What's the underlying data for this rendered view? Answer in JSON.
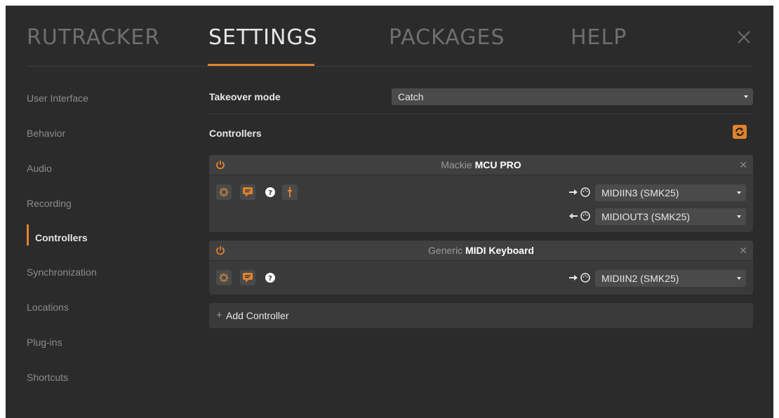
{
  "header": {
    "tabs": [
      {
        "label": "RUTRACKER",
        "active": false
      },
      {
        "label": "SETTINGS",
        "active": true
      },
      {
        "label": "PACKAGES",
        "active": false
      },
      {
        "label": "HELP",
        "active": false
      }
    ],
    "close_icon": "close-icon"
  },
  "sidebar": {
    "items": [
      {
        "label": "User Interface"
      },
      {
        "label": "Behavior"
      },
      {
        "label": "Audio"
      },
      {
        "label": "Recording"
      },
      {
        "label": "Controllers",
        "active": true
      },
      {
        "label": "Synchronization"
      },
      {
        "label": "Locations"
      },
      {
        "label": "Plug-ins"
      },
      {
        "label": "Shortcuts"
      }
    ]
  },
  "main": {
    "takeover_label": "Takeover mode",
    "takeover_value": "Catch",
    "controllers_label": "Controllers",
    "refresh_icon": "refresh-icon",
    "controllers": [
      {
        "vendor": "Mackie",
        "model": "MCU PRO",
        "inputs": [
          {
            "direction": "in",
            "value": "MIDIIN3 (SMK25)"
          }
        ],
        "outputs": [
          {
            "direction": "out",
            "value": "MIDIOUT3 (SMK25)"
          }
        ]
      },
      {
        "vendor": "Generic",
        "model": "MIDI Keyboard",
        "inputs": [
          {
            "direction": "in",
            "value": "MIDIIN2 (SMK25)"
          }
        ]
      }
    ],
    "add_controller_label": "Add Controller"
  },
  "colors": {
    "accent": "#e0832d",
    "background": "#2b2b2b",
    "panel": "#3a3a3a"
  }
}
